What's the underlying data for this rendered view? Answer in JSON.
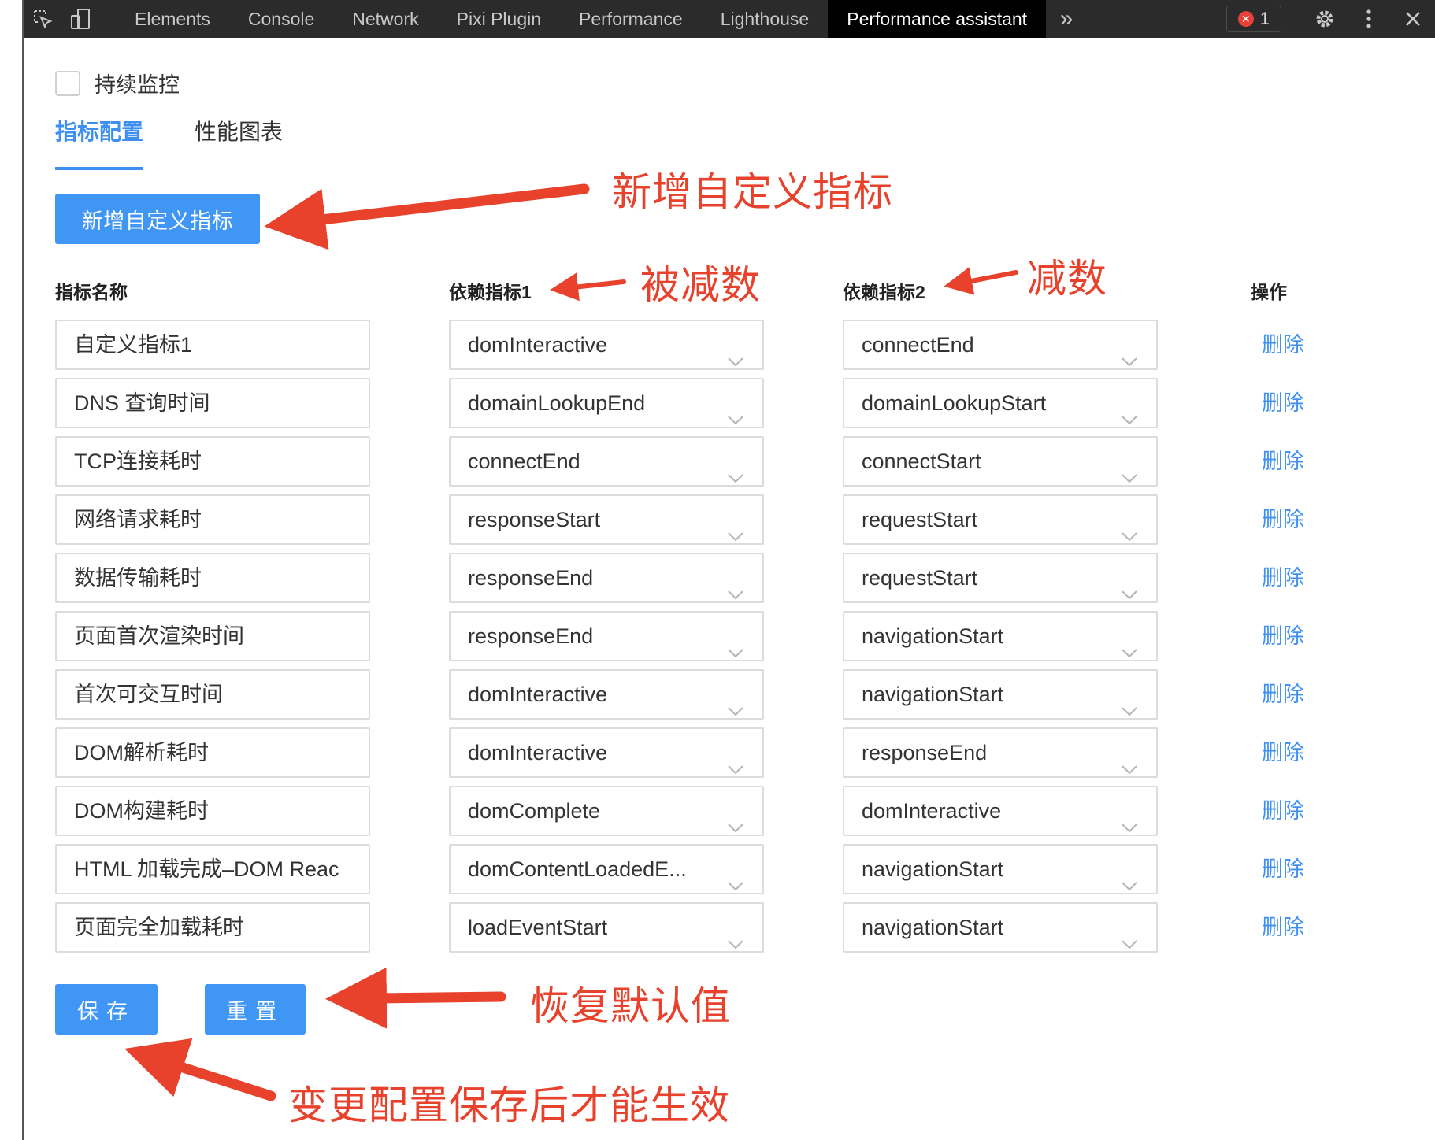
{
  "devtools": {
    "tabs": [
      "Elements",
      "Console",
      "Network",
      "Pixi Plugin",
      "Performance",
      "Lighthouse",
      "Performance assistant"
    ],
    "active_tab": "Performance assistant",
    "more_glyph": "»",
    "error_count": "1",
    "icons": [
      "inspect-element-icon",
      "device-toolbar-icon",
      "more-tabs-icon",
      "error-icon",
      "settings-gear-icon",
      "kebab-menu-icon",
      "close-icon"
    ]
  },
  "monitor": {
    "label": "持续监控",
    "checked": false
  },
  "tabs": [
    {
      "label": "指标配置",
      "active": true
    },
    {
      "label": "性能图表",
      "active": false
    }
  ],
  "add_button": "新增自定义指标",
  "table": {
    "headers": [
      "指标名称",
      "依赖指标1",
      "依赖指标2",
      "操作"
    ],
    "rows": [
      {
        "name": "自定义指标1",
        "dep1": "domInteractive",
        "dep2": "connectEnd",
        "action": "删除"
      },
      {
        "name": "DNS 查询时间",
        "dep1": "domainLookupEnd",
        "dep2": "domainLookupStart",
        "action": "删除"
      },
      {
        "name": "TCP连接耗时",
        "dep1": "connectEnd",
        "dep2": "connectStart",
        "action": "删除"
      },
      {
        "name": "网络请求耗时",
        "dep1": "responseStart",
        "dep2": "requestStart",
        "action": "删除"
      },
      {
        "name": "数据传输耗时",
        "dep1": "responseEnd",
        "dep2": "requestStart",
        "action": "删除"
      },
      {
        "name": "页面首次渲染时间",
        "dep1": "responseEnd",
        "dep2": "navigationStart",
        "action": "删除"
      },
      {
        "name": "首次可交互时间",
        "dep1": "domInteractive",
        "dep2": "navigationStart",
        "action": "删除"
      },
      {
        "name": "DOM解析耗时",
        "dep1": "domInteractive",
        "dep2": "responseEnd",
        "action": "删除"
      },
      {
        "name": "DOM构建耗时",
        "dep1": "domComplete",
        "dep2": "domInteractive",
        "action": "删除"
      },
      {
        "name": "HTML 加载完成–DOM Reac",
        "dep1": "domContentLoadedE...",
        "dep2": "navigationStart",
        "action": "删除"
      },
      {
        "name": "页面完全加载耗时",
        "dep1": "loadEventStart",
        "dep2": "navigationStart",
        "action": "删除"
      }
    ]
  },
  "buttons": {
    "save": "保存",
    "reset": "重置"
  },
  "annotations": {
    "add_metric": "新增自定义指标",
    "minuend": "被减数",
    "subtrahend": "减数",
    "restore_defaults": "恢复默认值",
    "save_hint": "变更配置保存后才能生效"
  },
  "colors": {
    "accent": "#3d8ff2",
    "button": "#4096f5",
    "annotation": "#e8412c",
    "toolbar_bg": "#2b2b2b"
  }
}
